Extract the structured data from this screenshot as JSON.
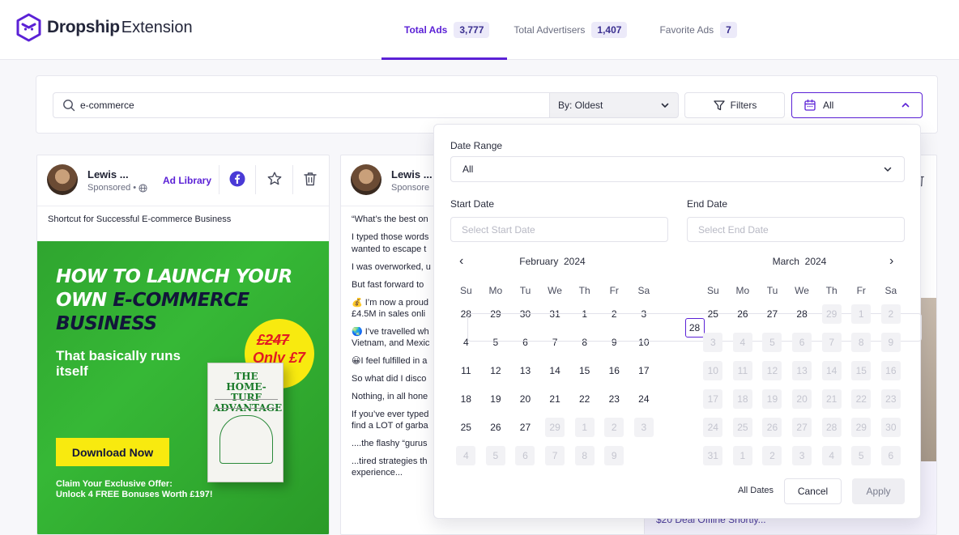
{
  "brand": {
    "name_bold": "Dropship",
    "name_light": "Extension"
  },
  "tabs": [
    {
      "label": "Total Ads",
      "count": "3,777",
      "active": true
    },
    {
      "label": "Total Advertisers",
      "count": "1,407",
      "active": false
    },
    {
      "label": "Favorite Ads",
      "count": "7",
      "active": false
    }
  ],
  "toolbar": {
    "search_value": "e-commerce",
    "sort_label": "By: Oldest",
    "filters_label": "Filters",
    "date_label": "All"
  },
  "cards": [
    {
      "name": "Lewis ...",
      "sponsored": "Sponsored •",
      "ad_library": "Ad Library",
      "description": "Shortcut for Successful E-commerce Business",
      "creative": {
        "headline_1": "HOW TO LAUNCH YOUR",
        "headline_2a": "OWN ",
        "headline_2b": "E-COMMERCE",
        "headline_3": "BUSINESS",
        "sub": "That basically runs itself",
        "old_price": "£247",
        "new_price": "Only £7",
        "book_title": "THE HOME-TURF ADVANTAGE",
        "cta": "Download Now",
        "claim_1": "Claim Your Exclusive Offer:",
        "claim_2": "Unlock 4 FREE Bonuses Worth £197!"
      }
    },
    {
      "name": "Lewis ...",
      "sponsored": "Sponsore",
      "paragraphs": [
        "“What’s the best on",
        "I typed those words",
        "wanted to escape t",
        "I was overworked, u",
        "But fast forward to",
        "💰 I’m now a proud",
        "£4.5M in sales onli",
        "🌏 I’ve travelled wh",
        "Vietnam, and Mexic",
        "😀I feel fulfilled in a",
        "So what did I disco",
        "Nothing, in all hone",
        "If you’ve ever typed",
        "find a LOT of garba",
        "....the flashy “gurus",
        "...tired strategies th",
        "experience..."
      ]
    },
    {
      "footer_text": "$20 Deal Offline Shortly..."
    }
  ],
  "date_picker": {
    "range_label": "Date Range",
    "range_value": "All",
    "start_label": "Start Date",
    "start_placeholder": "Select Start Date",
    "end_label": "End Date",
    "end_placeholder": "Select End Date",
    "weekdays": [
      "Su",
      "Mo",
      "Tu",
      "We",
      "Th",
      "Fr",
      "Sa"
    ],
    "left_month": {
      "month": "February",
      "year": "2024",
      "days": [
        [
          "28",
          "in"
        ],
        [
          "29",
          "in"
        ],
        [
          "30",
          "in"
        ],
        [
          "31",
          "in"
        ],
        [
          "1",
          "in"
        ],
        [
          "2",
          "in"
        ],
        [
          "3",
          "in"
        ],
        [
          "4",
          "in"
        ],
        [
          "5",
          "in"
        ],
        [
          "6",
          "in"
        ],
        [
          "7",
          "in"
        ],
        [
          "8",
          "in"
        ],
        [
          "9",
          "in"
        ],
        [
          "10",
          "in"
        ],
        [
          "11",
          "in"
        ],
        [
          "12",
          "in"
        ],
        [
          "13",
          "in"
        ],
        [
          "14",
          "in"
        ],
        [
          "15",
          "in"
        ],
        [
          "16",
          "in"
        ],
        [
          "17",
          "in"
        ],
        [
          "18",
          "in"
        ],
        [
          "19",
          "in"
        ],
        [
          "20",
          "in"
        ],
        [
          "21",
          "in"
        ],
        [
          "22",
          "in"
        ],
        [
          "23",
          "in"
        ],
        [
          "24",
          "in"
        ],
        [
          "25",
          "in"
        ],
        [
          "26",
          "in"
        ],
        [
          "27",
          "in"
        ],
        [
          "28",
          "sel"
        ],
        [
          "29",
          "off"
        ],
        [
          "1",
          "off"
        ],
        [
          "2",
          "off"
        ],
        [
          "3",
          "off"
        ],
        [
          "4",
          "off"
        ],
        [
          "5",
          "off"
        ],
        [
          "6",
          "off"
        ],
        [
          "7",
          "off"
        ],
        [
          "8",
          "off"
        ],
        [
          "9",
          "off"
        ]
      ]
    },
    "right_month": {
      "month": "March",
      "year": "2024",
      "days": [
        [
          "25",
          "in"
        ],
        [
          "26",
          "in"
        ],
        [
          "27",
          "in"
        ],
        [
          "28",
          "in"
        ],
        [
          "29",
          "off"
        ],
        [
          "1",
          "off"
        ],
        [
          "2",
          "off"
        ],
        [
          "3",
          "off"
        ],
        [
          "4",
          "off"
        ],
        [
          "5",
          "off"
        ],
        [
          "6",
          "off"
        ],
        [
          "7",
          "off"
        ],
        [
          "8",
          "off"
        ],
        [
          "9",
          "off"
        ],
        [
          "10",
          "off"
        ],
        [
          "11",
          "off"
        ],
        [
          "12",
          "off"
        ],
        [
          "13",
          "off"
        ],
        [
          "14",
          "off"
        ],
        [
          "15",
          "off"
        ],
        [
          "16",
          "off"
        ],
        [
          "17",
          "off"
        ],
        [
          "18",
          "off"
        ],
        [
          "19",
          "off"
        ],
        [
          "20",
          "off"
        ],
        [
          "21",
          "off"
        ],
        [
          "22",
          "off"
        ],
        [
          "23",
          "off"
        ],
        [
          "24",
          "off"
        ],
        [
          "25",
          "off"
        ],
        [
          "26",
          "off"
        ],
        [
          "27",
          "off"
        ],
        [
          "28",
          "off"
        ],
        [
          "29",
          "off"
        ],
        [
          "30",
          "off"
        ],
        [
          "31",
          "off"
        ],
        [
          "1",
          "off"
        ],
        [
          "2",
          "off"
        ],
        [
          "3",
          "off"
        ],
        [
          "4",
          "off"
        ],
        [
          "5",
          "off"
        ],
        [
          "6",
          "off"
        ]
      ]
    },
    "all_dates_label": "All Dates",
    "cancel_label": "Cancel",
    "apply_label": "Apply"
  },
  "colors": {
    "accent": "#5b21d6",
    "facebook": "#4a3ad6",
    "creative_green": "#36b836",
    "creative_yellow": "#f8ea0f"
  }
}
